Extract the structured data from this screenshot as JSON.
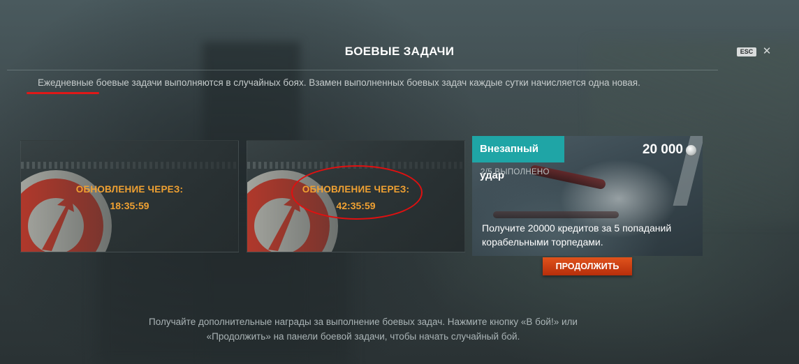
{
  "header": {
    "title": "БОЕВЫЕ ЗАДАЧИ",
    "esc_label": "ESC",
    "close_glyph": "✕"
  },
  "description": "Ежедневные боевые задачи выполняются в случайных боях. Взамен выполненных боевых задач каждые сутки начисляется одна новая.",
  "locked_cards": [
    {
      "update_label": "ОБНОВЛЕНИЕ ЧЕРЕЗ:",
      "timer": "18:35:59"
    },
    {
      "update_label": "ОБНОВЛЕНИЕ ЧЕРЕЗ:",
      "timer": "42:35:59"
    }
  ],
  "mission": {
    "title": "Внезапный удар",
    "reward": "20 000",
    "reward_icon": "credits-coin-icon",
    "progress": "2/5 ВЫПОЛНЕНО",
    "description": "Получите 20000 кредитов за 5 попаданий корабельными торпедами.",
    "continue_label": "ПРОДОЛЖИТЬ"
  },
  "footer": {
    "line1": "Получайте дополнительные награды за выполнение боевых задач. Нажмите кнопку «В бой!» или",
    "line2": "«Продолжить» на панели боевой задачи, чтобы начать случайный бой."
  },
  "colors": {
    "accent_teal": "#1fa5a6",
    "timer_orange": "#f0a132",
    "button_red": "#c93f12",
    "annotation_red": "#e01818"
  }
}
